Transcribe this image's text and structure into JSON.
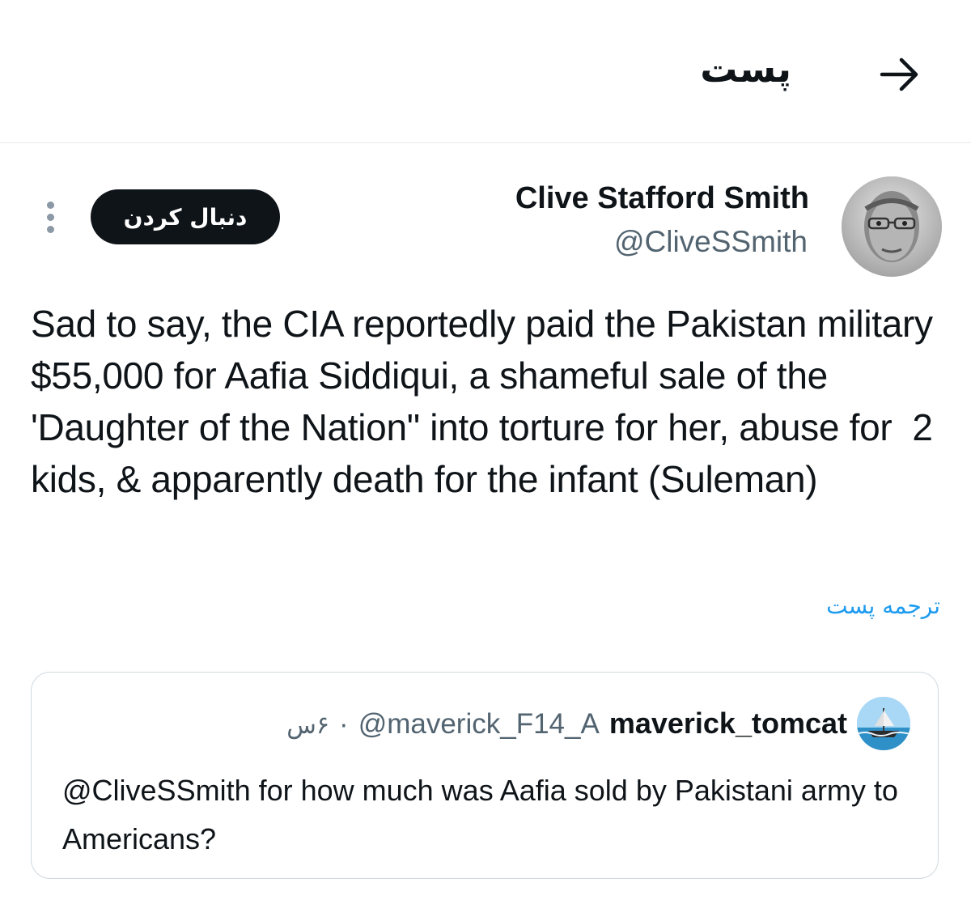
{
  "header": {
    "title": "پست",
    "back_icon": "arrow-right-icon"
  },
  "tweet": {
    "author_name": "Clive Stafford Smith",
    "author_handle": "@CliveSSmith",
    "follow_label": "دنبال کردن",
    "more_icon": "more-vertical-icon",
    "text": "Sad to say, the CIA reportedly paid the Pakistan military $55,000 for Aafia Siddiqui, a shameful sale of the 'Daughter of the Nation\" into torture for her, abuse for  2 kids, & apparently death for the infant (Suleman)",
    "translate_label": "ترجمه پست"
  },
  "quote": {
    "author_name": "maverick_tomcat",
    "author_handle": "@maverick_F14_A",
    "separator": "·",
    "time": "۶س",
    "text": "@CliveSSmith for how much was Aafia sold by Pakistani army to Americans?"
  },
  "colors": {
    "text_primary": "#0f1419",
    "text_secondary": "#536471",
    "link": "#1d9bf0",
    "border": "#cfd9de",
    "button_bg": "#0f1419"
  }
}
